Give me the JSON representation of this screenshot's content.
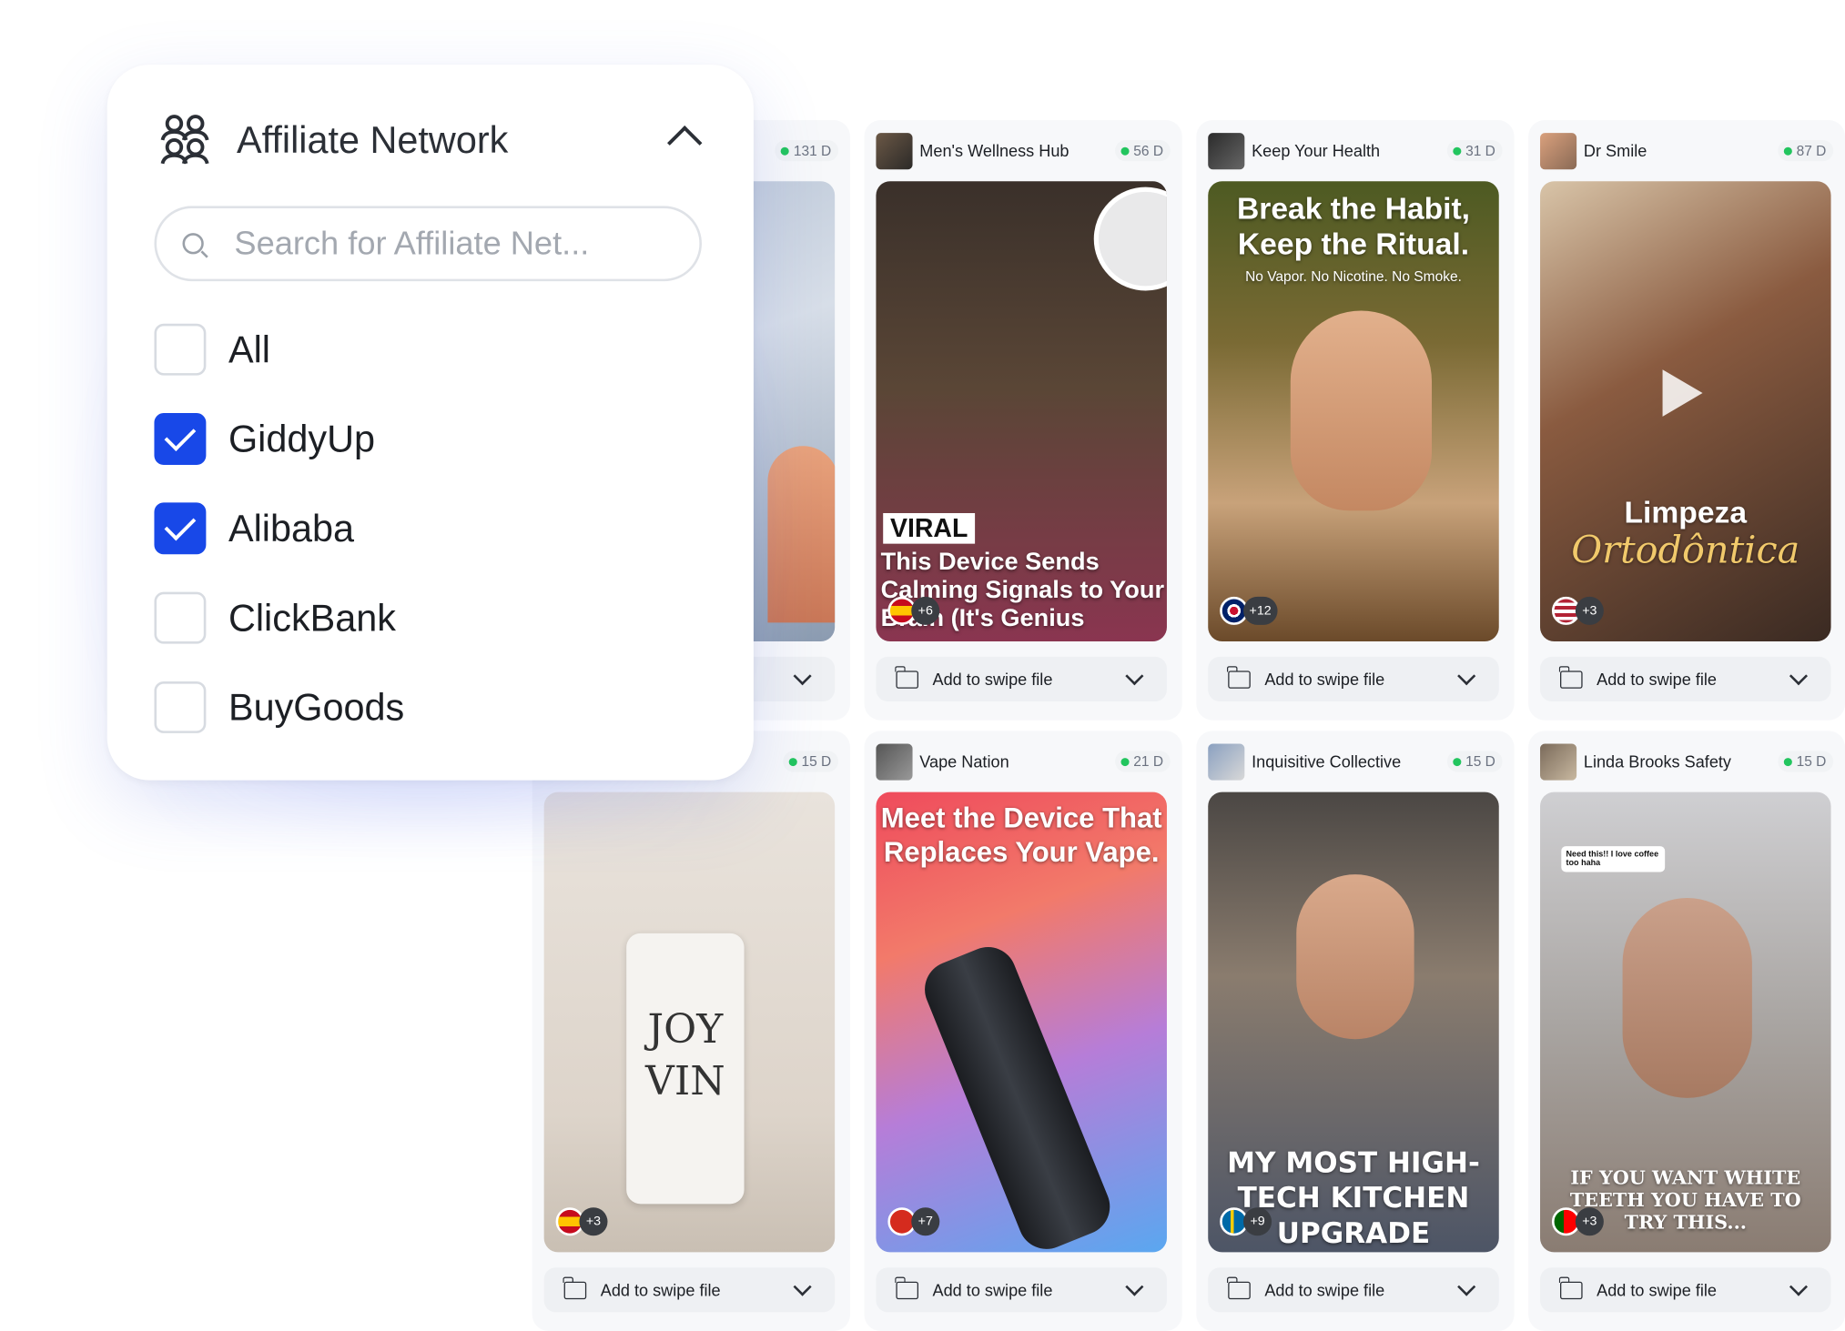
{
  "filter": {
    "title": "Affiliate Network",
    "search_placeholder": "Search for Affiliate Net...",
    "options": [
      {
        "label": "All",
        "checked": false
      },
      {
        "label": "GiddyUp",
        "checked": true
      },
      {
        "label": "Alibaba",
        "checked": true
      },
      {
        "label": "ClickBank",
        "checked": false
      },
      {
        "label": "BuyGoods",
        "checked": false
      }
    ]
  },
  "swipe_label": "Add to swipe file",
  "cards": [
    {
      "brand": "",
      "days": "131 D",
      "flag_more": ""
    },
    {
      "brand": "Men's Wellness Hub",
      "days": "56 D",
      "flag_more": "+6",
      "caption_tag": "VIRAL",
      "caption": "This Device Sends Calming Signals to Your Brain (It's Genius"
    },
    {
      "brand": "Keep Your Health",
      "days": "31 D",
      "flag_more": "+12",
      "caption": "Break the Habit, Keep the Ritual.",
      "caption_sub": "No Vapor. No Nicotine. No Smoke."
    },
    {
      "brand": "Dr Smile",
      "days": "87 D",
      "flag_more": "+3",
      "caption": "Limpeza",
      "caption_sub": "Ortodôntica"
    },
    {
      "brand": "",
      "days": "15 D",
      "flag_more": "+3",
      "product_line1": "JOY",
      "product_line2": "VIN"
    },
    {
      "brand": "Vape Nation",
      "days": "21 D",
      "flag_more": "+7",
      "caption": "Meet the Device That Replaces Your Vape."
    },
    {
      "brand": "Inquisitive Collective",
      "days": "15 D",
      "flag_more": "+9",
      "caption": "MY MOST HIGH-TECH KITCHEN UPGRADE"
    },
    {
      "brand": "Linda Brooks Safety",
      "days": "15 D",
      "flag_more": "+3",
      "caption": "IF YOU WANT WHITE TEETH YOU HAVE TO TRY THIS...",
      "comment": "Need this!! I love coffee too haha"
    }
  ],
  "colors": {
    "accent": "#1848e8",
    "dot": "#22c55e"
  }
}
